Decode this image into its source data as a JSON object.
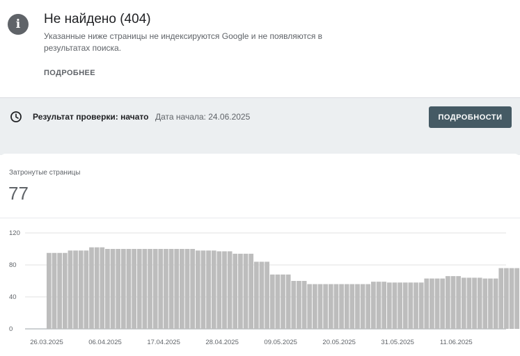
{
  "issue": {
    "title": "Не найдено (404)",
    "description": "Указанные ниже страницы не индексируются Google и не появляются в результатах поиска.",
    "more_label": "ПОДРОБНЕЕ",
    "icon": "info-icon"
  },
  "validation": {
    "icon": "clock-icon",
    "result_label": "Результат проверки: начато",
    "start_date": "Дата начала: 24.06.2025",
    "details_button": "ПОДРОБНОСТИ"
  },
  "metric": {
    "label": "Затронутые страницы",
    "value": "77"
  },
  "chart_data": {
    "type": "bar",
    "start_date": "26.03.2025",
    "ylim": [
      0,
      120
    ],
    "yticks": [
      0,
      40,
      80,
      120
    ],
    "xticks": [
      "26.03.2025",
      "06.04.2025",
      "17.04.2025",
      "28.04.2025",
      "09.05.2025",
      "20.05.2025",
      "31.05.2025",
      "11.06.2025"
    ],
    "bar_color": "#bdbdbd",
    "grid": true,
    "values": [
      95,
      95,
      95,
      95,
      98,
      98,
      98,
      98,
      102,
      102,
      102,
      100,
      100,
      100,
      100,
      100,
      100,
      100,
      100,
      100,
      100,
      100,
      100,
      100,
      100,
      100,
      100,
      100,
      98,
      98,
      98,
      98,
      97,
      97,
      97,
      94,
      94,
      94,
      94,
      84,
      84,
      84,
      68,
      68,
      68,
      68,
      60,
      60,
      60,
      56,
      56,
      56,
      56,
      56,
      56,
      56,
      56,
      56,
      56,
      56,
      56,
      59,
      59,
      59,
      58,
      58,
      58,
      58,
      58,
      58,
      58,
      63,
      63,
      63,
      63,
      66,
      66,
      66,
      64,
      64,
      64,
      64,
      63,
      63,
      63,
      76,
      76,
      76,
      76
    ]
  }
}
